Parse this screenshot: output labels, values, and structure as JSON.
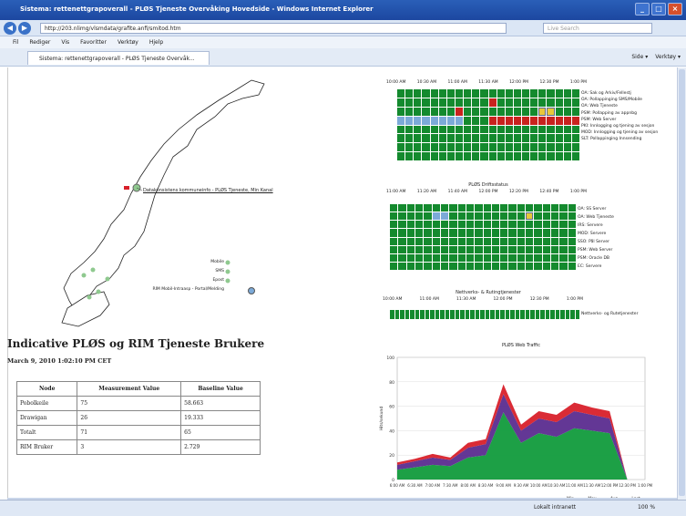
{
  "window": {
    "title": "Sistema: rettenettgrapoverall - PLØS Tjeneste Overvåking Hovedside - Windows Internet Explorer",
    "url": "http://203.nlimg/vlsmdata/grafite.anfi/smitod.htm",
    "search_placeholder": "Live Search",
    "tab_label": "Sistema: rettenettgrapoverall - PLØS Tjeneste Overvåk...",
    "menu": [
      "Fil",
      "Rediger",
      "Vis",
      "Favoritter",
      "Verktøy",
      "Hjelp"
    ],
    "commands": [
      "Side ▾",
      "Verktøy ▾"
    ],
    "status_left": "",
    "status_zone": "Lokalt intranett",
    "status_zoom": "100 %"
  },
  "map": {
    "callout": "Datakonsistens kommuneinfo - PLØS Tjeneste, Min Kanal",
    "legend": [
      "Mobile",
      "SMS",
      "Epost",
      "RIM Mobil-Intraasp - Portal/Melding"
    ]
  },
  "users_section": {
    "heading": "Indicative PLØS og RIM Tjeneste Brukere",
    "timestamp": "March 9, 2010 1:02:10 PM CET",
    "columns": [
      "Node",
      "Measurement Value",
      "Baseline Value"
    ],
    "rows": [
      [
        "Pobolkeile",
        "75",
        "58.663"
      ],
      [
        "Drawigan",
        "26",
        "19.333"
      ],
      [
        "Totalt",
        "71",
        "65"
      ],
      [
        "RIM Bruker",
        "3",
        "2.729"
      ]
    ]
  },
  "grid1": {
    "title": "",
    "times": [
      "10:00 AM",
      "10:30 AM",
      "11:00 AM",
      "11:30 AM",
      "12:00 PM",
      "12:30 PM",
      "1:00 PM"
    ],
    "rows": [
      "OA: Sak og Arkiv/Fellestj",
      "OA: Pollappinging SMS/Mobile",
      "OA: Web Tjeneste",
      "PSM: Pollapping av appnbg",
      "PSM: Web Server",
      "PKI: Innlogging og tjening av sesjon",
      "MOD: Innlogging og tjening av sesjon",
      "SLT: Pollappinging Innsending"
    ],
    "cols": 22,
    "status": [
      "GGGGGGGGGGGGGGGGGGGGGG",
      "GGGGGGGGGGGRGGGGGGGGGG",
      "GGGGGGGRGGGGGGGGGYYGGG",
      "BBBBBBBBGGGRRRRRRRRRRR",
      "GGGGGGGGGGGGGGGGGGGGGG",
      "GGGGGGGGGGGGGGGGGGGGGG",
      "GGGGGGGGGGGGGGGGGGGGGG",
      "GGGGGGGGGGGGGGGGGGGGGG"
    ]
  },
  "grid2": {
    "title": "PLØS Driftsstatus",
    "times": [
      "11:00 AM",
      "11:20 AM",
      "11:40 AM",
      "12:00 PM",
      "12:20 PM",
      "12:40 PM",
      "1:00 PM"
    ],
    "rows": [
      "OA: SS Server",
      "OA: Web Tjeneste",
      "IRS: Servere",
      "MOD: Servere",
      "SSO: Pål Server",
      "PSM: Web Server",
      "PSM: Oracle DB",
      "EC: Servere"
    ],
    "cols": 22,
    "status": [
      "GGGGGGGGGGGGGGGGGGGGGG",
      "GGGGGBBGGGGGGGGGYGGGGG",
      "GGGGGGGGGGGGGGGGGGGGGG",
      "GGGGGGGGGGGGGGGGGGGGGG",
      "GGGGGGGGGGGGGGGGGGGGGG",
      "GGGGGGGGGGGGGGGGGGGGGG",
      "GGGGGGGGGGGGGGGGGGGGGG",
      "GGGGGGGGGGGGGGGGGGGGGG"
    ]
  },
  "grid3": {
    "title": "Nettverks- & Rutingtjenester",
    "times": [
      "10:00 AM",
      "11:00 AM",
      "11:30 AM",
      "12:00 PM",
      "12:30 PM",
      "1:00 PM"
    ],
    "rows": [
      "Nettverks- og Rutetjenester"
    ],
    "cols": 38,
    "status": [
      "GGGGGGGGGGGGGGGGGGGGGGGGGGGGGGGGGGGGGG"
    ]
  },
  "traffic": {
    "title": "PLØS Web Traffic",
    "ylabel": "Hits/sekund",
    "yticks": [
      "0",
      "20",
      "40",
      "60",
      "80",
      "100"
    ],
    "xticks": [
      "6:00 AM",
      "6:30 AM",
      "7:00 AM",
      "7:30 AM",
      "8:00 AM",
      "8:30 AM",
      "9:00 AM",
      "9:30 AM",
      "10:00 AM",
      "10:30 AM",
      "11:00 AM",
      "11:30 AM",
      "12:00 PM",
      "12:30 PM",
      "1:00 PM"
    ],
    "ranges": [
      "Min",
      "Max",
      "Avg",
      "Last"
    ]
  },
  "chart_data": {
    "type": "area",
    "title": "PLØS Web Traffic",
    "ylabel": "Hits/sekund",
    "ylim": [
      0,
      100
    ],
    "x": [
      "6:00 AM",
      "6:30 AM",
      "7:00 AM",
      "7:30 AM",
      "8:00 AM",
      "8:30 AM",
      "9:00 AM",
      "9:30 AM",
      "10:00 AM",
      "10:30 AM",
      "11:00 AM",
      "11:30 AM",
      "12:00 PM",
      "12:30 PM",
      "1:00 PM"
    ],
    "series": [
      {
        "name": "",
        "values": [
          8,
          10,
          12,
          11,
          18,
          20,
          55,
          30,
          38,
          35,
          42,
          40,
          38,
          0,
          0
        ]
      },
      {
        "name": "",
        "values": [
          4,
          5,
          6,
          5,
          8,
          9,
          15,
          10,
          12,
          12,
          14,
          13,
          12,
          0,
          0
        ]
      },
      {
        "name": "",
        "values": [
          2,
          2,
          3,
          2,
          4,
          4,
          8,
          5,
          6,
          6,
          7,
          6,
          6,
          0,
          0
        ]
      }
    ],
    "colors": [
      "#119b3c",
      "#5b2c8f",
      "#d8202a"
    ]
  }
}
